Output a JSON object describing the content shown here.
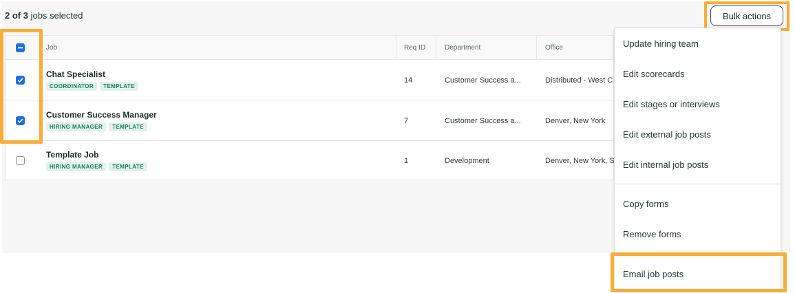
{
  "selection": {
    "count": "2 of 3",
    "suffix": " jobs selected"
  },
  "bulk_actions": {
    "label": "Bulk actions"
  },
  "table": {
    "headers": {
      "job": "Job",
      "req_id": "Req ID",
      "department": "Department",
      "office": "Office"
    },
    "rows": [
      {
        "title": "Chat Specialist",
        "tags": [
          "COORDINATOR",
          "TEMPLATE"
        ],
        "req_id": "14",
        "department": "Customer Success a...",
        "office": "Distributed - West C",
        "checked": true
      },
      {
        "title": "Customer Success Manager",
        "tags": [
          "HIRING MANAGER",
          "TEMPLATE"
        ],
        "req_id": "7",
        "department": "Customer Success a...",
        "office": "Denver, New York",
        "checked": true
      },
      {
        "title": "Template Job",
        "tags": [
          "HIRING MANAGER",
          "TEMPLATE"
        ],
        "req_id": "1",
        "department": "Development",
        "office": "Denver, New York, S",
        "checked": false
      }
    ]
  },
  "menu": {
    "items": [
      "Update hiring team",
      "Edit scorecards",
      "Edit stages or interviews",
      "Edit external job posts",
      "Edit internal job posts",
      "Copy forms",
      "Remove forms",
      "Email job posts"
    ]
  },
  "colors": {
    "highlight": "#f9ad3a",
    "checkbox": "#1f6fe0",
    "tag_bg": "#dff3ec",
    "tag_text": "#1d7a5c"
  }
}
